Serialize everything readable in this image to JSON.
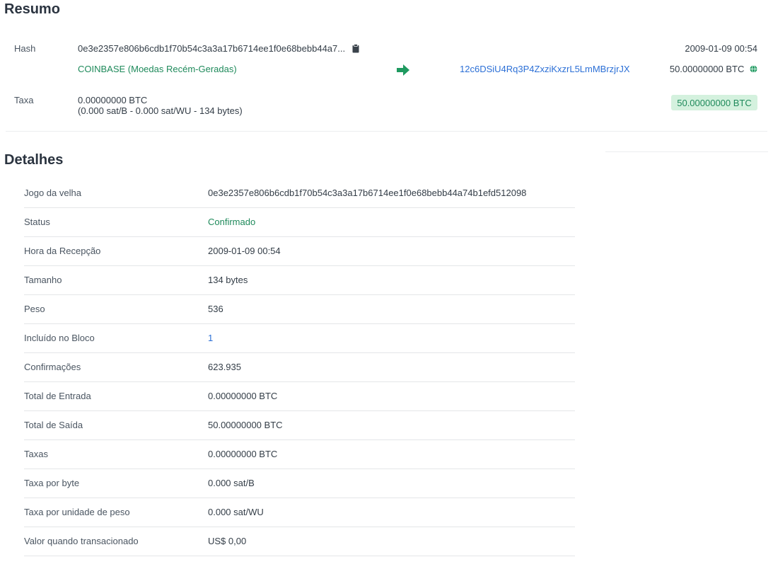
{
  "resumo": {
    "title": "Resumo",
    "hash_label": "Hash",
    "hash_value": "0e3e2357e806b6cdb1f70b54c3a3a17b6714ee1f0e68bebb44a7...",
    "timestamp": "2009-01-09 00:54",
    "input_source": "COINBASE (Moedas Recém-Geradas)",
    "output_address": "12c6DSiU4Rq3P4ZxziKxzrL5LmMBrzjrJX",
    "output_amount": "50.00000000 BTC",
    "fee_label": "Taxa",
    "fee_value": "0.00000000 BTC",
    "fee_detail": "(0.000 sat/B - 0.000 sat/WU - 134 bytes)",
    "total_badge": "50.00000000 BTC",
    "icons": {
      "copy": "clipboard-icon",
      "arrow": "arrow-right-icon",
      "globe": "globe-icon"
    },
    "colors": {
      "green": "#1f8a5b",
      "link": "#2b6fd6",
      "badge_bg": "#d4f1de"
    }
  },
  "detalhes": {
    "title": "Detalhes",
    "rows": [
      {
        "key": "Jogo da velha",
        "value": "0e3e2357e806b6cdb1f70b54c3a3a17b6714ee1f0e68bebb44a74b1efd512098"
      },
      {
        "key": "Status",
        "value": "Confirmado"
      },
      {
        "key": "Hora da Recepção",
        "value": "2009-01-09 00:54"
      },
      {
        "key": "Tamanho",
        "value": "134 bytes"
      },
      {
        "key": "Peso",
        "value": "536"
      },
      {
        "key": "Incluído no Bloco",
        "value": "1"
      },
      {
        "key": "Confirmações",
        "value": "623.935"
      },
      {
        "key": "Total de Entrada",
        "value": "0.00000000 BTC"
      },
      {
        "key": "Total de Saída",
        "value": "50.00000000 BTC"
      },
      {
        "key": "Taxas",
        "value": "0.00000000 BTC"
      },
      {
        "key": "Taxa por byte",
        "value": "0.000 sat/B"
      },
      {
        "key": "Taxa por unidade de peso",
        "value": "0.000 sat/WU"
      },
      {
        "key": "Valor quando transacionado",
        "value": "US$ 0,00"
      }
    ]
  }
}
